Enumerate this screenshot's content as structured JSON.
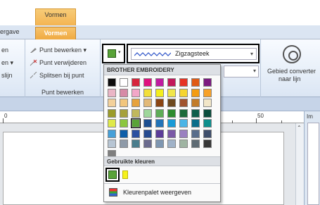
{
  "contextual_tab": {
    "label": "Vormen"
  },
  "tabs": {
    "left_partial": "ergave",
    "active": "Vormen"
  },
  "ribbon": {
    "left_partial_items": [
      "en",
      "en ▾",
      "slijn"
    ],
    "punt_bewerken_group": {
      "items": [
        "Punt bewerken ▾",
        "Punt verwijderen",
        "Splitsen bij punt"
      ],
      "label": "Punt bewerken"
    },
    "stitch_select": {
      "value": "Zigzagsteek"
    },
    "big_button": {
      "line1": "Gebied converter",
      "line2": "naar lijn"
    }
  },
  "ruler": {
    "numbers": [
      "0",
      "50"
    ]
  },
  "side_panel": {
    "tag": "Im"
  },
  "palette": {
    "title": "BROTHER EMBROIDERY",
    "used_title": "Gebruikte kleuren",
    "footer_label": "Kleurenpalet weergeven",
    "rows": [
      [
        "#0c0c0c",
        "#ffffff",
        "#d7263d",
        "#e0127f",
        "#c01aa0",
        "#c2185b",
        "#e63323",
        "#e05a14",
        "#7c1a80"
      ],
      [
        "#eab6c6",
        "#d68aa6",
        "#f2a6c8",
        "#f2df3a",
        "#f4ee1d",
        "#f1e64a",
        "#f6d530",
        "#f39c12",
        "#f7a128"
      ],
      [
        "#f3d19b",
        "#f2c67d",
        "#e6a23c",
        "#e2b978",
        "#8b4513",
        "#6e4a1f",
        "#a0522d",
        "#c27c2a",
        "#f2e6c8"
      ],
      [
        "#9b9b2a",
        "#a6a13b",
        "#c1b85d",
        "#9ed69a",
        "#5fad56",
        "#2e8b2e",
        "#1d6b3a",
        "#0f5e4b",
        "#0b4d3d"
      ],
      [
        "#dfe94a",
        "#8cc63f",
        "#59a338",
        "#1d4f91",
        "#2173b8",
        "#1a9ad6",
        "#4bb5e6",
        "#0c6e8a",
        "#0f8f8c"
      ],
      [
        "#46a0d8",
        "#0d5ea8",
        "#2a4fa0",
        "#274b8f",
        "#5c3d99",
        "#7b5aa6",
        "#9a7fc0",
        "#596d8b",
        "#3e4e6b"
      ],
      [
        "#b7c5d3",
        "#8e9aa8",
        "#4a7d8c",
        "#6b6b8e",
        "#7e96b1",
        "#a0b2c8",
        "#9fb4a2",
        "#5e6b74",
        "#383838"
      ],
      [
        "#7f7f7f"
      ]
    ],
    "selected_cell": "Groen",
    "used_colors": [
      "#59a338",
      "#f6f21a"
    ]
  },
  "colors": {
    "ribbon_bg": "#dbe6f4",
    "tab_accent": "#f0a83f",
    "selected_color": "#59a338"
  }
}
